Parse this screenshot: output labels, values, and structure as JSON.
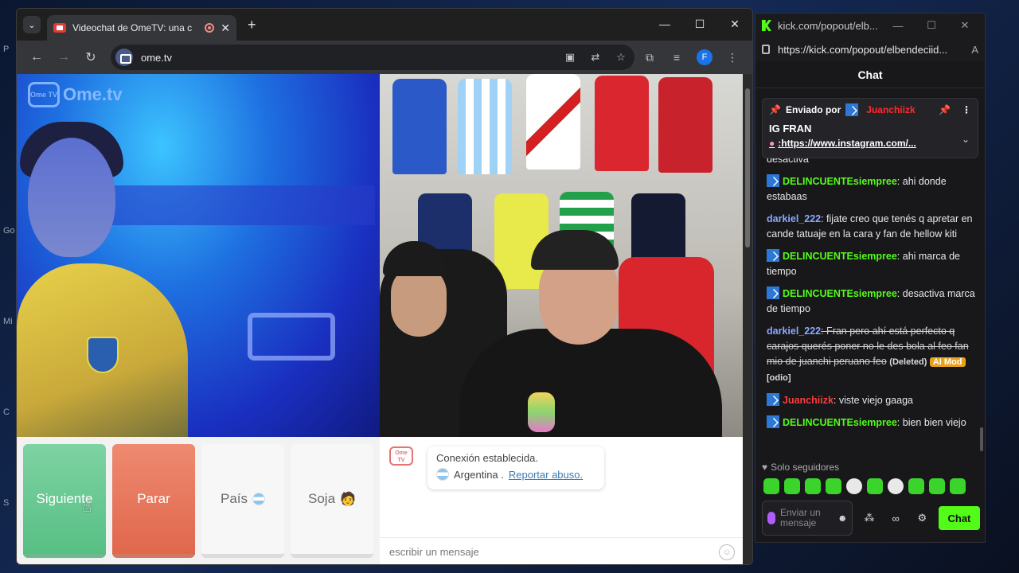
{
  "desktop": {
    "fragments": [
      "P",
      "Go",
      "Mi",
      "C",
      "S"
    ]
  },
  "browser": {
    "tab_title": "Videochat de OmeTV: una c",
    "url": "ome.tv",
    "profile_initial": "F"
  },
  "ometv": {
    "logo_small": "Ome TV",
    "logo_text": "Ome.tv",
    "buttons": {
      "next": "Siguiente",
      "stop": "Parar",
      "country": "País",
      "gender": "Soja"
    },
    "system_logo": "Ome TV",
    "system_message": "Conexión establecida.",
    "country_name": "Argentina .",
    "report_link": "Reportar abuso.",
    "message_placeholder": "escribir un mensaje"
  },
  "kick": {
    "window_title": "kick.com/popout/elb...",
    "url": "https://kick.com/popout/elbendeciid...",
    "chat_header": "Chat",
    "pinned": {
      "sent_by_label": "Enviado por",
      "sender": "Juanchiizk",
      "title": "IG FRAN",
      "link": ":https://www.instagram.com/..."
    },
    "messages": [
      {
        "name": "",
        "text": "desactiva"
      },
      {
        "name": "DELINCUENTEsiempree",
        "text": ": ahi donde estabaas"
      },
      {
        "name": "darkiel_222",
        "text": ": fijate creo que tenés q apretar en cande tatuaje en la cara y fan de hellow kiti"
      },
      {
        "name": "DELINCUENTEsiempree",
        "text": ": ahi marca de tiempo"
      },
      {
        "name": "DELINCUENTEsiempree",
        "text": ": desactiva marca de tiempo"
      },
      {
        "name": "darkiel_222",
        "text": ": Fran pero ahí está perfecto q carajos querés poner no le des bola al feo fan mio de juanchi peruano feo",
        "deleted_label": "(Deleted)",
        "mod_label": "AI Mod",
        "reason": "[odio]"
      },
      {
        "name": "Juanchiizk",
        "text": ": viste viejo gaaga"
      },
      {
        "name": "DELINCUENTEsiempree",
        "text": ": bien bien viejo"
      }
    ],
    "followers_only": "Solo seguidores",
    "input_placeholder": "Enviar un mensaje",
    "chat_button": "Chat"
  },
  "colors": {
    "kick_green": "#53fc18",
    "next_green": "#6ccb95",
    "stop_red": "#e6735a"
  }
}
